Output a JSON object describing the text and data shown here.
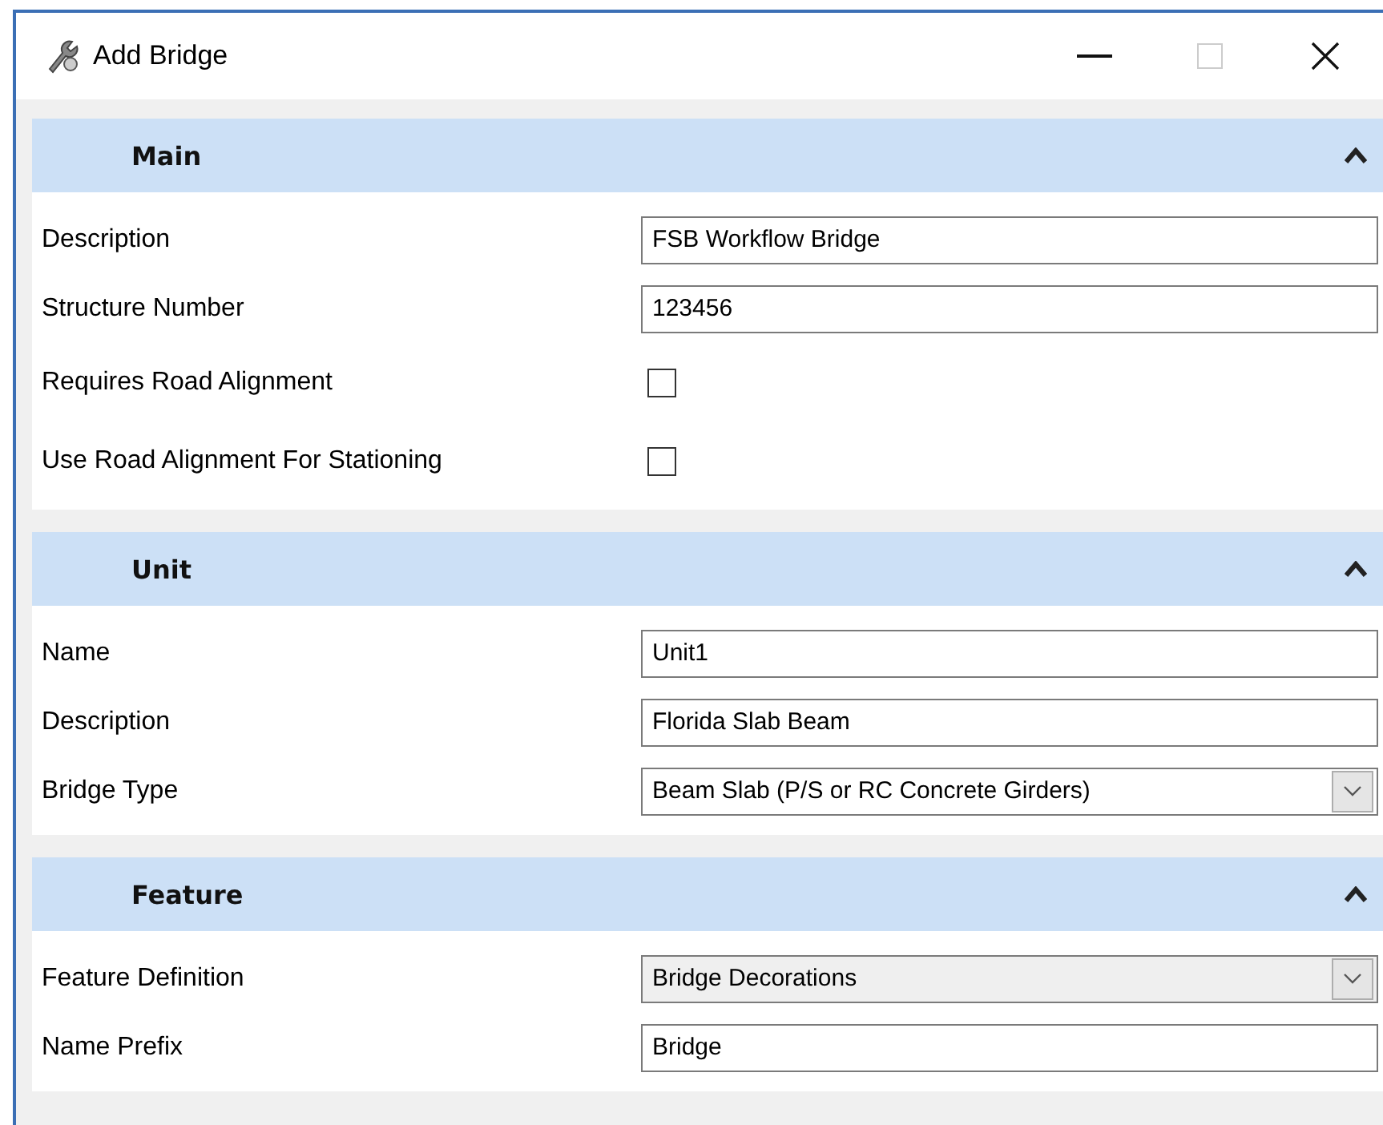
{
  "window": {
    "title": "Add Bridge"
  },
  "sections": [
    {
      "title": "Main",
      "expanded": true,
      "fields": [
        {
          "kind": "text",
          "label": "Description",
          "value": "FSB Workflow Bridge"
        },
        {
          "kind": "text",
          "label": "Structure Number",
          "value": "123456"
        },
        {
          "kind": "checkbox",
          "label": "Requires Road Alignment",
          "checked": false
        },
        {
          "kind": "checkbox",
          "label": "Use Road Alignment For Stationing",
          "checked": false
        }
      ]
    },
    {
      "title": "Unit",
      "expanded": true,
      "fields": [
        {
          "kind": "text",
          "label": "Name",
          "value": "Unit1"
        },
        {
          "kind": "text",
          "label": "Description",
          "value": "Florida Slab Beam"
        },
        {
          "kind": "dropdown",
          "label": "Bridge Type",
          "value": "Beam Slab (P/S or RC Concrete Girders)",
          "disabled": false
        }
      ]
    },
    {
      "title": "Feature",
      "expanded": true,
      "fields": [
        {
          "kind": "dropdown",
          "label": "Feature Definition",
          "value": "Bridge Decorations",
          "disabled": true
        },
        {
          "kind": "text",
          "label": "Name Prefix",
          "value": "Bridge"
        }
      ]
    }
  ]
}
